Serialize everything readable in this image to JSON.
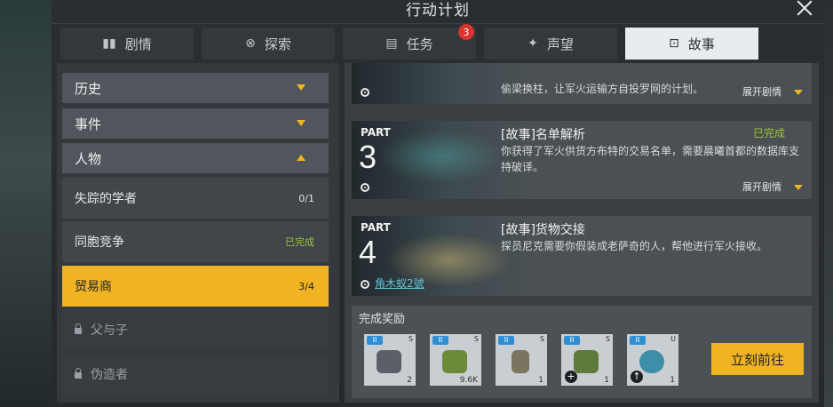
{
  "window": {
    "title": "行动计划"
  },
  "tabs": [
    {
      "label": "剧情",
      "icon": "book-icon"
    },
    {
      "label": "探索",
      "icon": "explore-icon"
    },
    {
      "label": "任务",
      "icon": "task-list-icon",
      "badge": "3"
    },
    {
      "label": "声望",
      "icon": "reputation-icon"
    },
    {
      "label": "故事",
      "icon": "story-icon",
      "active": true
    }
  ],
  "sidebar": {
    "categories": [
      {
        "label": "历史",
        "expanded": false
      },
      {
        "label": "事件",
        "expanded": false
      },
      {
        "label": "人物",
        "expanded": true
      }
    ],
    "items": [
      {
        "label": "失踪的学者",
        "status": "0/1"
      },
      {
        "label": "同胞竞争",
        "status": "已完成"
      },
      {
        "label": "贸易商",
        "status": "3/4",
        "selected": true
      },
      {
        "label": "父与子",
        "locked": true
      },
      {
        "label": "伪造者",
        "locked": true
      }
    ]
  },
  "cards": [
    {
      "desc": "偷梁换柱，让军火运输方自投罗网的计划。",
      "expand": "展开剧情"
    },
    {
      "part": "PART",
      "num": "3",
      "title": "[故事]名单解析",
      "status": "已完成",
      "desc": "你获得了军火供货方布特的交易名单，需要晨曦首都的数据库支持破译。",
      "expand": "展开剧情"
    },
    {
      "part": "PART",
      "num": "4",
      "title": "[故事]货物交接",
      "desc": "探员尼克需要你假装成老萨奇的人，帮他进行军火接收。",
      "location": "角木蚁2號"
    }
  ],
  "reward": {
    "title": "完成奖励",
    "items": [
      {
        "tag": "II",
        "side": "S",
        "count": "2"
      },
      {
        "tag": "II",
        "side": "S",
        "count": "9.6K"
      },
      {
        "tag": "II",
        "side": "S",
        "count": "1"
      },
      {
        "tag": "II",
        "side": "S",
        "count": "1",
        "badge": "+"
      },
      {
        "tag": "II",
        "side": "U",
        "count": "1",
        "badge": "↑"
      }
    ],
    "go_label": "立刻前往"
  },
  "colors": {
    "accent": "#f0b323",
    "done": "#9fc33a",
    "badge": "#d8332f",
    "link": "#5ec5d6"
  }
}
